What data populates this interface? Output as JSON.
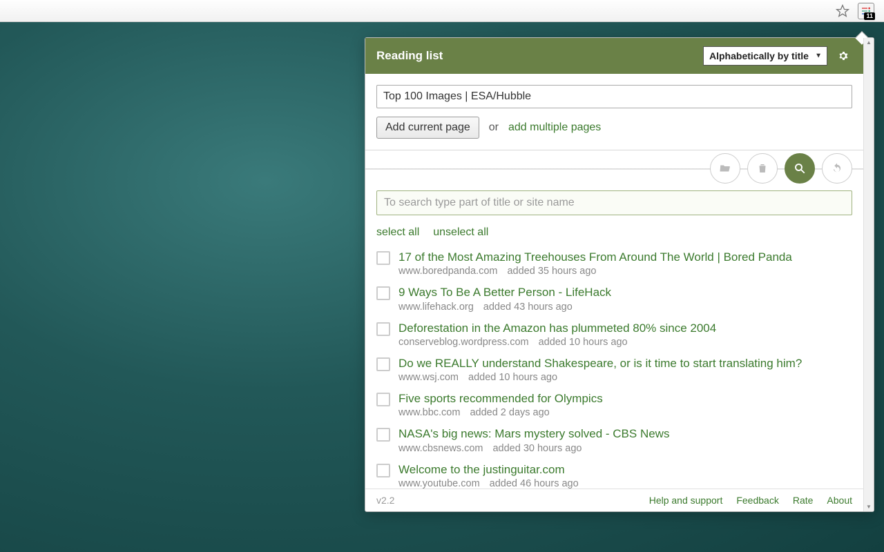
{
  "extension": {
    "badge": "11"
  },
  "header": {
    "title": "Reading list",
    "sort": "Alphabetically by title"
  },
  "add": {
    "current_title": "Top 100 Images | ESA/Hubble",
    "button": "Add current page",
    "or": "or",
    "multiple": "add multiple pages"
  },
  "search": {
    "placeholder": "To search type part of title or site name"
  },
  "selection": {
    "select_all": "select all",
    "unselect_all": "unselect all"
  },
  "items": [
    {
      "title": "17 of the Most Amazing Treehouses From Around The World | Bored Panda",
      "site": "www.boredpanda.com",
      "added": "added 35 hours ago"
    },
    {
      "title": "9 Ways To Be A Better Person - LifeHack",
      "site": "www.lifehack.org",
      "added": "added 43 hours ago"
    },
    {
      "title": "Deforestation in the Amazon has plummeted 80% since 2004",
      "site": "conserveblog.wordpress.com",
      "added": "added 10 hours ago"
    },
    {
      "title": "Do we REALLY understand Shakespeare, or is it time to start translating him?",
      "site": "www.wsj.com",
      "added": "added 10 hours ago"
    },
    {
      "title": "Five sports recommended for Olympics",
      "site": "www.bbc.com",
      "added": "added 2 days ago"
    },
    {
      "title": "NASA's big news: Mars mystery solved - CBS News",
      "site": "www.cbsnews.com",
      "added": "added 30 hours ago"
    },
    {
      "title": "Welcome to the justinguitar.com",
      "site": "www.youtube.com",
      "added": "added 46 hours ago"
    }
  ],
  "footer": {
    "version": "v2.2",
    "help": "Help and support",
    "feedback": "Feedback",
    "rate": "Rate",
    "about": "About"
  }
}
